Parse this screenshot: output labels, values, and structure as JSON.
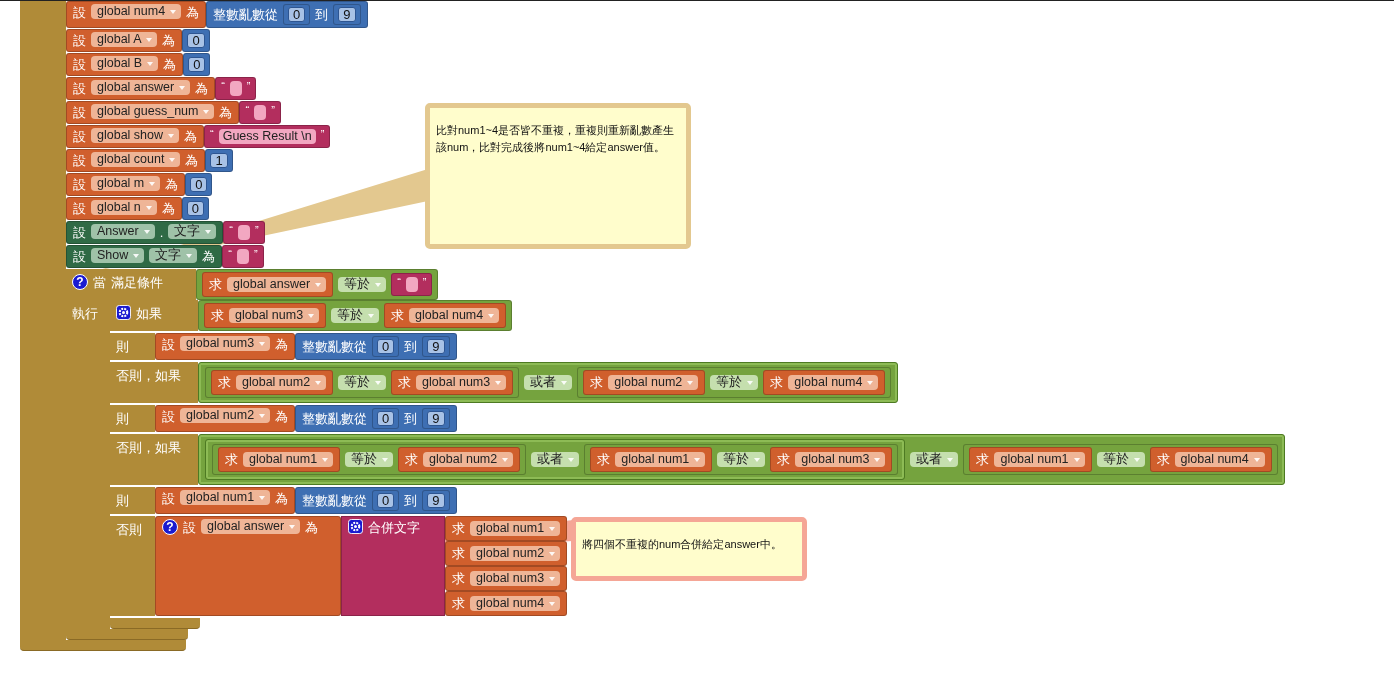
{
  "statements": [
    {
      "kind": "set",
      "verb": "設",
      "var": "global num4",
      "to": "為",
      "value": {
        "kind": "random",
        "label": "整數亂數從",
        "from": {
          "kind": "number",
          "value": "0"
        },
        "sep": "到",
        "upto": {
          "kind": "number",
          "value": "9"
        }
      }
    },
    {
      "kind": "set",
      "verb": "設",
      "var": "global A",
      "to": "為",
      "value": {
        "kind": "number",
        "value": "0"
      }
    },
    {
      "kind": "set",
      "verb": "設",
      "var": "global B",
      "to": "為",
      "value": {
        "kind": "number",
        "value": "0"
      }
    },
    {
      "kind": "set",
      "verb": "設",
      "var": "global answer",
      "to": "為",
      "value": {
        "kind": "text",
        "open": "“",
        "close": "”"
      }
    },
    {
      "kind": "set",
      "verb": "設",
      "var": "global guess_num",
      "to": "為",
      "value": {
        "kind": "text",
        "open": "“",
        "close": "”"
      }
    },
    {
      "kind": "set",
      "verb": "設",
      "var": "global show",
      "to": "為",
      "value": {
        "kind": "text",
        "open": "“",
        "value": "Guess Result \\n",
        "close": "”"
      }
    },
    {
      "kind": "set",
      "verb": "設",
      "var": "global count",
      "to": "為",
      "value": {
        "kind": "number",
        "value": "1"
      }
    },
    {
      "kind": "set",
      "verb": "設",
      "var": "global m",
      "to": "為",
      "value": {
        "kind": "number",
        "value": "0"
      }
    },
    {
      "kind": "set",
      "verb": "設",
      "var": "global n",
      "to": "為",
      "value": {
        "kind": "number",
        "value": "0"
      }
    },
    {
      "kind": "set_prop",
      "verb": "設",
      "component": "Answer",
      "dot": ".",
      "property": "文字",
      "value": {
        "kind": "text",
        "open": "“",
        "close": "”"
      }
    },
    {
      "kind": "set_prop",
      "verb": "設",
      "component": "Show",
      "property": "文字",
      "to": "為",
      "value": {
        "kind": "text",
        "open": "“",
        "close": "”"
      }
    },
    {
      "kind": "while",
      "help": "?",
      "label": "當",
      "cond_label": "滿足條件",
      "condition": {
        "kind": "compare",
        "left": {
          "kind": "get",
          "verb": "求",
          "var": "global answer"
        },
        "op": "等於",
        "right": {
          "kind": "text",
          "open": "“",
          "close": "”"
        }
      },
      "body_label": "執行",
      "body": {
        "kind": "if",
        "clauses": [
          {
            "kind": "if",
            "label": "如果",
            "condition": {
              "kind": "compare",
              "left": {
                "kind": "get",
                "verb": "求",
                "var": "global num3"
              },
              "op": "等於",
              "right": {
                "kind": "get",
                "verb": "求",
                "var": "global num4"
              }
            }
          },
          {
            "kind": "then",
            "label": "則",
            "statement": {
              "kind": "set",
              "verb": "設",
              "var": "global num3",
              "to": "為",
              "value": {
                "kind": "random",
                "label": "整數亂數從",
                "from": {
                  "kind": "number",
                  "value": "0"
                },
                "sep": "到",
                "upto": {
                  "kind": "number",
                  "value": "9"
                }
              }
            }
          },
          {
            "kind": "elseif",
            "label": "否則，如果",
            "condition": {
              "kind": "or",
              "op": "或者",
              "left": {
                "kind": "compare",
                "left": {
                  "kind": "get",
                  "verb": "求",
                  "var": "global num2"
                },
                "op": "等於",
                "right": {
                  "kind": "get",
                  "verb": "求",
                  "var": "global num3"
                }
              },
              "right": {
                "kind": "compare",
                "left": {
                  "kind": "get",
                  "verb": "求",
                  "var": "global num2"
                },
                "op": "等於",
                "right": {
                  "kind": "get",
                  "verb": "求",
                  "var": "global num4"
                }
              }
            }
          },
          {
            "kind": "then",
            "label": "則",
            "statement": {
              "kind": "set",
              "verb": "設",
              "var": "global num2",
              "to": "為",
              "value": {
                "kind": "random",
                "label": "整數亂數從",
                "from": {
                  "kind": "number",
                  "value": "0"
                },
                "sep": "到",
                "upto": {
                  "kind": "number",
                  "value": "9"
                }
              }
            }
          },
          {
            "kind": "elseif",
            "label": "否則，如果",
            "condition": {
              "kind": "or",
              "op": "或者",
              "left": {
                "kind": "or",
                "op": "或者",
                "left": {
                  "kind": "compare",
                  "left": {
                    "kind": "get",
                    "verb": "求",
                    "var": "global num1"
                  },
                  "op": "等於",
                  "right": {
                    "kind": "get",
                    "verb": "求",
                    "var": "global num2"
                  }
                },
                "right": {
                  "kind": "compare",
                  "left": {
                    "kind": "get",
                    "verb": "求",
                    "var": "global num1"
                  },
                  "op": "等於",
                  "right": {
                    "kind": "get",
                    "verb": "求",
                    "var": "global num3"
                  }
                }
              },
              "right": {
                "kind": "compare",
                "left": {
                  "kind": "get",
                  "verb": "求",
                  "var": "global num1"
                },
                "op": "等於",
                "right": {
                  "kind": "get",
                  "verb": "求",
                  "var": "global num4"
                }
              }
            }
          },
          {
            "kind": "then",
            "label": "則",
            "statement": {
              "kind": "set",
              "verb": "設",
              "var": "global num1",
              "to": "為",
              "value": {
                "kind": "random",
                "label": "整數亂數從",
                "from": {
                  "kind": "number",
                  "value": "0"
                },
                "sep": "到",
                "upto": {
                  "kind": "number",
                  "value": "9"
                }
              }
            }
          },
          {
            "kind": "else",
            "label": "否則",
            "statement": {
              "kind": "set",
              "help": "?",
              "verb": "設",
              "var": "global answer",
              "to": "為",
              "value": {
                "kind": "join",
                "label": "合併文字",
                "items": [
                  {
                    "kind": "get",
                    "verb": "求",
                    "var": "global num1"
                  },
                  {
                    "kind": "get",
                    "verb": "求",
                    "var": "global num2"
                  },
                  {
                    "kind": "get",
                    "verb": "求",
                    "var": "global num3"
                  },
                  {
                    "kind": "get",
                    "verb": "求",
                    "var": "global num4"
                  }
                ]
              }
            }
          }
        ]
      }
    }
  ],
  "comments": [
    {
      "text": "比對num1~4是否皆不重複，重複則重新亂數產生該num，比對完成後將num1~4給定answer值。",
      "color": "#e3c88f"
    },
    {
      "text": "將四個不重複的num合併給定answer中。",
      "color": "#f5a696"
    }
  ]
}
